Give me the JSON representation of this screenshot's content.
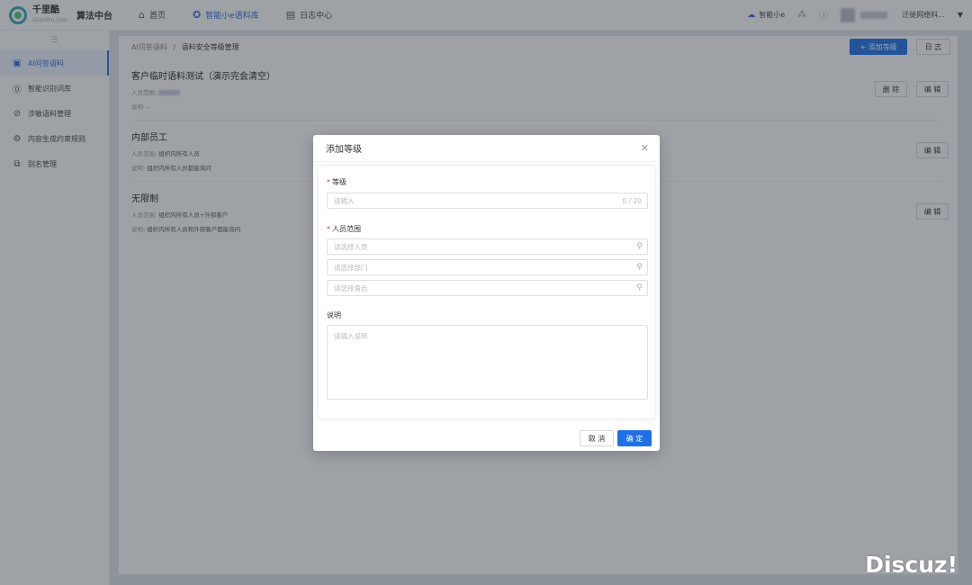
{
  "topbar": {
    "brand_name": "千里酷",
    "brand_sub": "Qianliku.com",
    "platform": "算法中台",
    "nav": [
      {
        "icon": "home-icon",
        "glyph": "⌂",
        "label": "首页"
      },
      {
        "icon": "graduation-cap-icon",
        "glyph": "✪",
        "label": "智能小e语料库"
      },
      {
        "icon": "log-document-icon",
        "glyph": "▤",
        "label": "日志中心"
      }
    ],
    "assistant": "智能小e",
    "user_name": "迁徙网络科..."
  },
  "sidebar": {
    "items": [
      {
        "icon": "chat-qa-icon",
        "glyph": "▣",
        "label": "AI问答语料"
      },
      {
        "icon": "recognition-icon",
        "glyph": "⓪",
        "label": "智能识别词库"
      },
      {
        "icon": "forbidden-icon",
        "glyph": "⊘",
        "label": "涉敏语料管理"
      },
      {
        "icon": "rules-icon",
        "glyph": "⚙",
        "label": "内容生成约束规则"
      },
      {
        "icon": "alias-icon",
        "glyph": "⧉",
        "label": "别名管理"
      }
    ]
  },
  "main": {
    "breadcrumb_root": "AI问答语料",
    "breadcrumb_sep": "/",
    "breadcrumb_current": "语料安全等级管理",
    "add_button": "+ 添加等级",
    "log_button": "日 志",
    "levels": [
      {
        "title": "客户临时语料测试（演示完会清空）",
        "scope_label": "人员范围:",
        "scope_value": "",
        "desc_label": "说明:",
        "desc_value": "-",
        "delete_label": "删 除",
        "edit_label": "编 辑"
      },
      {
        "title": "内部员工",
        "scope_label": "人员范围:",
        "scope_value": "组织内所有人员",
        "desc_label": "说明:",
        "desc_value": "组织内所有人员都能询问",
        "edit_label": "编 辑"
      },
      {
        "title": "无限制",
        "scope_label": "人员范围:",
        "scope_value": "组织内所有人员+外部客户",
        "desc_label": "说明:",
        "desc_value": "组织内所有人员和外部客户都能询问",
        "edit_label": "编 辑"
      }
    ]
  },
  "modal": {
    "title": "添加等级",
    "level_label": "等级",
    "level_placeholder": "请输入",
    "level_count": "0 / 20",
    "scope_label": "人员范围",
    "person_placeholder": "请选择人员",
    "dept_placeholder": "请选择部门",
    "role_placeholder": "请选择角色",
    "desc_label": "说明",
    "desc_placeholder": "请输入说明",
    "cancel": "取 消",
    "confirm": "确 定"
  },
  "watermark": "Discuz!"
}
